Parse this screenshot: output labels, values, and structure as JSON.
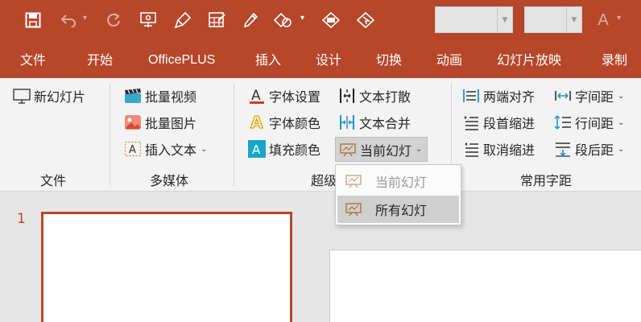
{
  "quick_access": {
    "icons": [
      "save-icon",
      "undo-icon",
      "redo-icon",
      "presenter-icon",
      "format-painter-icon",
      "table-icon",
      "eyedropper-icon",
      "shapes-icon",
      "slide-arrange-icon",
      "slide-select-icon",
      "font-color-icon"
    ],
    "font_combo_value": "",
    "size_combo_value": ""
  },
  "tabs": [
    "文件",
    "开始",
    "OfficePLUS",
    "插入",
    "设计",
    "切换",
    "动画",
    "幻灯片放映",
    "录制"
  ],
  "ribbon": {
    "file_group": {
      "new_slide": "新幻灯片",
      "label": "文件"
    },
    "media_group": {
      "batch_video": "批量视频",
      "batch_image": "批量图片",
      "insert_text": "插入文本",
      "label": "多媒体"
    },
    "text_group": {
      "font_settings": "字体设置",
      "font_color": "字体颜色",
      "fill_color": "填充颜色",
      "text_split": "文本打散",
      "text_merge": "文本合并",
      "current_slide": "当前幻灯",
      "label": "超级"
    },
    "para_group": {
      "justify": "两端对齐",
      "char_spacing": "字间距",
      "first_indent": "段首缩进",
      "line_spacing": "行间距",
      "cancel_indent": "取消缩进",
      "para_after": "段后距",
      "label": "常用字距"
    }
  },
  "dropdown": {
    "items": [
      "当前幻灯",
      "所有幻灯"
    ]
  },
  "slides": {
    "thumb_number": "1"
  },
  "colors": {
    "accent": "#b7472a",
    "ribbon_bg": "#f3f3f3",
    "workspace_bg": "#e6e6e6"
  }
}
